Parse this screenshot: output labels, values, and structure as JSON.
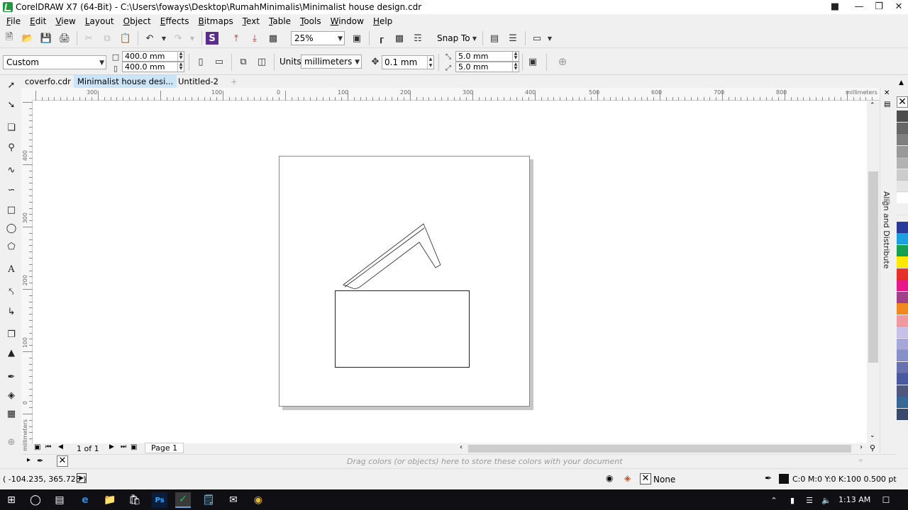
{
  "window": {
    "title": "CorelDRAW X7 (64-Bit) - C:\\Users\\foways\\Desktop\\RumahMinimalis\\Minimalist house design.cdr"
  },
  "menu": [
    "File",
    "Edit",
    "View",
    "Layout",
    "Object",
    "Effects",
    "Bitmaps",
    "Text",
    "Table",
    "Tools",
    "Window",
    "Help"
  ],
  "toolbar": {
    "zoom": "25%",
    "snap_to": "Snap To"
  },
  "property_bar": {
    "page_preset": "Custom",
    "width": "400.0 mm",
    "height": "400.0 mm",
    "units_label": "Units:",
    "units": "millimeters",
    "nudge": "0.1 mm",
    "dup_x": "5.0 mm",
    "dup_y": "5.0 mm"
  },
  "tabs": [
    "coverfo.cdr",
    "Minimalist house desi...",
    "Untitled-2"
  ],
  "ruler": {
    "h_labels": [
      "300",
      "200",
      "100",
      "0",
      "100",
      "200",
      "300",
      "400",
      "500",
      "600",
      "700",
      "800"
    ],
    "h_unit": "millimeters",
    "v_labels": [
      "400",
      "300",
      "200",
      "100",
      "0"
    ],
    "v_unit": "millimeters"
  },
  "docker": {
    "label": "Align and Distribute"
  },
  "page_nav": {
    "count": "1 of 1",
    "page_tab": "Page 1"
  },
  "color_docker_hint": "Drag colors (or objects) here to store these colors with your document",
  "status": {
    "coords": "( -104.235, 365.728 )",
    "fill": "None",
    "outline": "C:0 M:0 Y:0 K:100  0.500 pt"
  },
  "taskbar": {
    "time": "1:13 AM"
  },
  "palette_colors": [
    "#4d4d4d",
    "#666666",
    "#7f7f7f",
    "#999999",
    "#b3b3b3",
    "#cccccc",
    "#e5e5e5",
    "#ffffff",
    "#f0f0f0",
    "#2a3a9a",
    "#1aa0e0",
    "#13a050",
    "#ffe800",
    "#e8302a",
    "#e8188a",
    "#a0408a",
    "#f08a20",
    "#f09aa0",
    "#c8c0e8",
    "#a8a8d8",
    "#8890c8",
    "#6870b0",
    "#4a5aa0",
    "#505880",
    "#386898",
    "#3a4a6a"
  ]
}
